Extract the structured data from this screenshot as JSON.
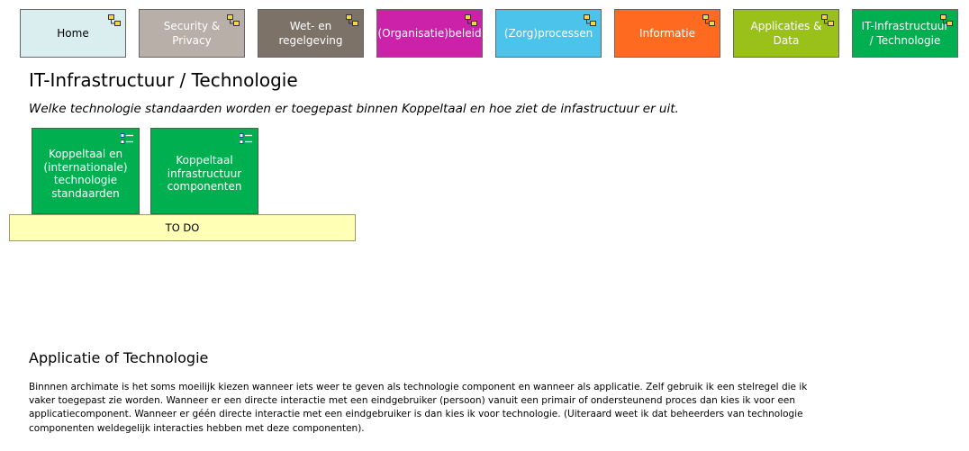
{
  "nav": {
    "items": [
      {
        "label": "Home",
        "bg": "#daeef0",
        "fg": "#000000"
      },
      {
        "label": "Security & Privacy",
        "bg": "#b8b0a8",
        "fg": "#ffffff"
      },
      {
        "label": "Wet- en regelgeving",
        "bg": "#7d7268",
        "fg": "#ffffff"
      },
      {
        "label": "(Organisatie)beleid",
        "bg": "#cc22aa",
        "fg": "#ffffff"
      },
      {
        "label": "(Zorg)processen",
        "bg": "#4cc3ea",
        "fg": "#ffffff"
      },
      {
        "label": "Informatie",
        "bg": "#ff6a21",
        "fg": "#ffffff"
      },
      {
        "label": "Applicaties & Data",
        "bg": "#99c11a",
        "fg": "#ffffff"
      },
      {
        "label": "IT-Infrastructuur / Technologie",
        "bg": "#00b050",
        "fg": "#ffffff"
      }
    ]
  },
  "page": {
    "title": "IT-Infrastructuur / Technologie",
    "subtitle": "Welke technologie standaarden worden er toegepast binnen Koppeltaal en hoe ziet de infastructuur er uit."
  },
  "elements": [
    {
      "label": "Koppeltaal en (internationale) technologie standaarden"
    },
    {
      "label": "Koppeltaal infrastructuur componenten"
    }
  ],
  "todo": {
    "label": "TO DO"
  },
  "section": {
    "heading": "Applicatie of Technologie",
    "body": "Binnnen archimate is het soms moeilijk kiezen wanneer iets weer te geven als technologie component en wanneer als applicatie. Zelf gebruik ik een stelregel die ik vaker toegepast zie worden. Wanneer er een directe interactie met een eindgebruiker (persoon) vanuit een primair of ondersteunend proces dan kies ik voor een applicatiecomponent. Wanneer er géén directe interactie met een eindgebruiker is dan kies ik voor technologie. (Uiteraard weet ik dat beheerders van technologie componenten weldegelijk interacties hebben met deze componenten)."
  },
  "icons": {
    "nav_icon": "model-reference-icon",
    "element_icon": "list-icon"
  }
}
